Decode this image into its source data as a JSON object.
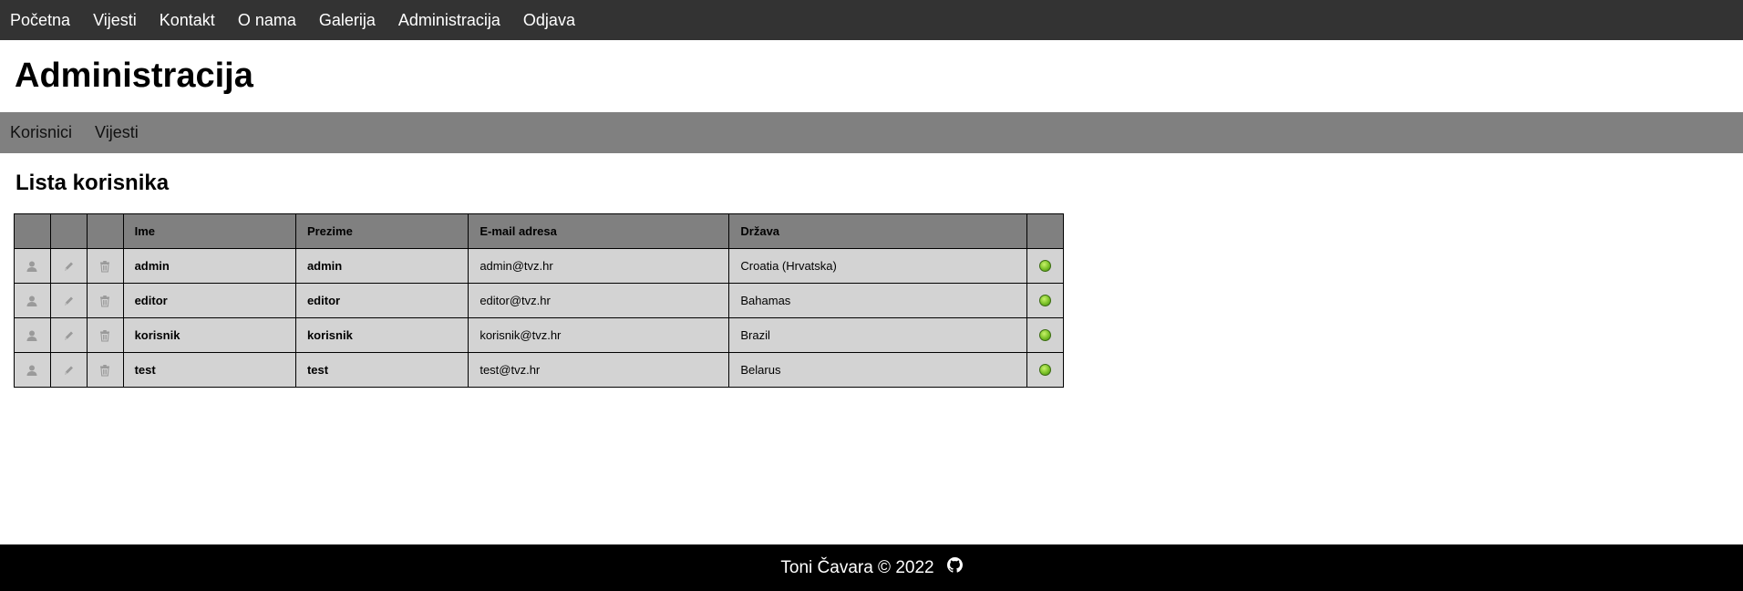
{
  "topnav": {
    "items": [
      {
        "label": "Početna"
      },
      {
        "label": "Vijesti"
      },
      {
        "label": "Kontakt"
      },
      {
        "label": "O nama"
      },
      {
        "label": "Galerija"
      },
      {
        "label": "Administracija"
      },
      {
        "label": "Odjava"
      }
    ]
  },
  "page": {
    "title": "Administracija"
  },
  "subnav": {
    "items": [
      {
        "label": "Korisnici"
      },
      {
        "label": "Vijesti"
      }
    ]
  },
  "users": {
    "title": "Lista korisnika",
    "columns": [
      "",
      "",
      "",
      "Ime",
      "Prezime",
      "E-mail adresa",
      "Država",
      ""
    ],
    "rows": [
      {
        "ime": "admin",
        "prezime": "admin",
        "email": "admin@tvz.hr",
        "drzava": "Croatia (Hrvatska)",
        "status": "active"
      },
      {
        "ime": "editor",
        "prezime": "editor",
        "email": "editor@tvz.hr",
        "drzava": "Bahamas",
        "status": "active"
      },
      {
        "ime": "korisnik",
        "prezime": "korisnik",
        "email": "korisnik@tvz.hr",
        "drzava": "Brazil",
        "status": "active"
      },
      {
        "ime": "test",
        "prezime": "test",
        "email": "test@tvz.hr",
        "drzava": "Belarus",
        "status": "active"
      }
    ],
    "row_icons": [
      "user-icon",
      "pencil-icon",
      "trash-icon"
    ],
    "status_color": "#7ac127"
  },
  "footer": {
    "text": "Toni Čavara © 2022",
    "icon": "github-icon"
  },
  "colors": {
    "topnav_bg": "#333333",
    "subnav_bg": "#808080",
    "table_header_bg": "#808080",
    "table_cell_bg": "#d3d3d3",
    "footer_bg": "#000000"
  }
}
